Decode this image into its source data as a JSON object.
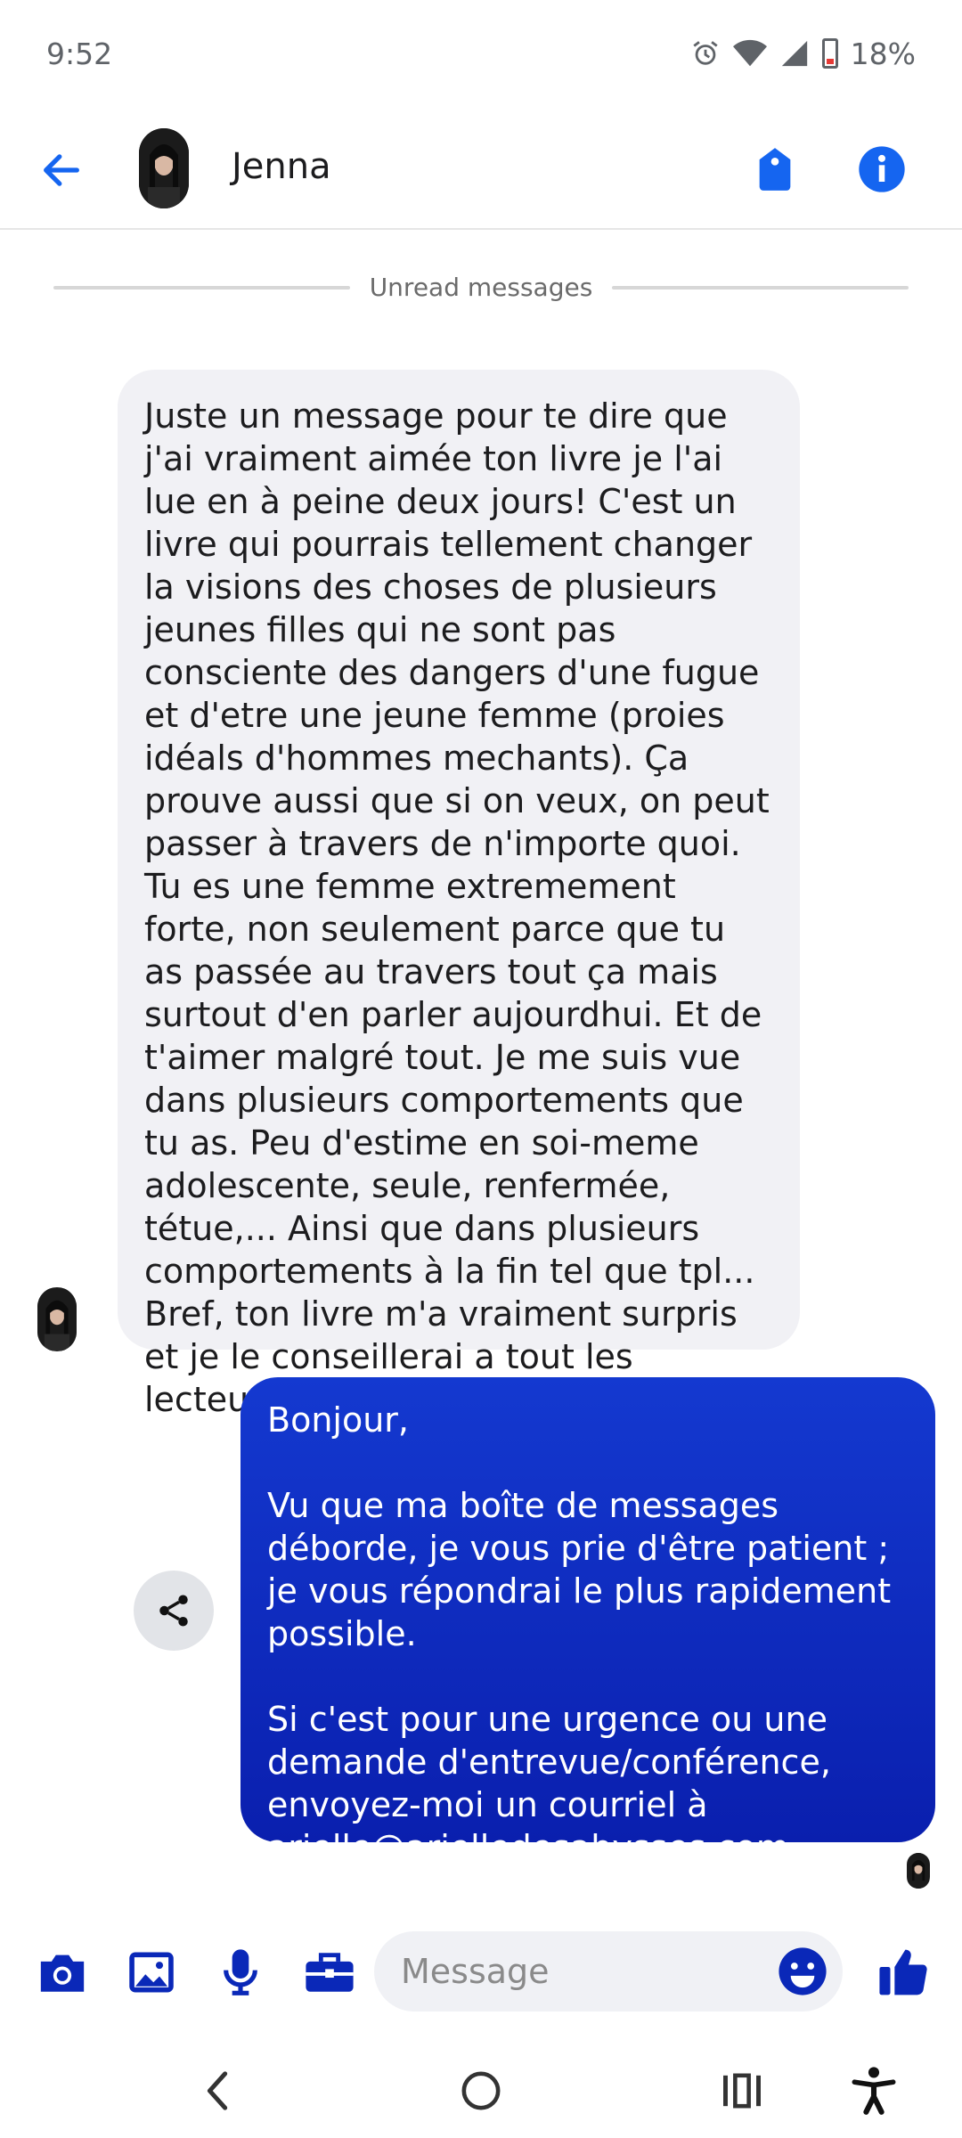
{
  "status_bar": {
    "time": "9:52",
    "battery": "18%"
  },
  "header": {
    "contact_name": "Jenna"
  },
  "divider": {
    "label": "Unread messages"
  },
  "messages": {
    "incoming": "Juste un message pour te dire que j'ai vraiment aimée ton livre je l'ai lue en à peine deux jours! C'est un livre qui pourrais tellement changer la visions des choses de plusieurs jeunes filles qui ne sont pas consciente des dangers d'une fugue et d'etre une jeune femme (proies idéals d'hommes mechants). Ça prouve aussi que si on veux, on peut passer à travers de n'importe quoi. Tu es une femme extremement forte, non seulement parce que tu as passée au travers tout ça mais surtout d'en parler aujourdhui. Et de t'aimer malgré tout. Je me suis vue dans plusieurs comportements que tu as. Peu d'estime en soi-meme adolescente, seule, renfermée, tétue,... Ainsi que dans plusieurs comportements à la fin tel que tpl... Bref, ton livre m'a vraiment surpris et je le conseillerai a tout les lecteurs",
    "incoming_emoji": "😉",
    "outgoing_p1": "Bonjour,",
    "outgoing_p2": "Vu que ma boîte de messages déborde, je vous prie d'être patient ; je vous répondrai le plus rapidement possible.",
    "outgoing_p3": "Si c'est pour une urgence ou une demande d'entrevue/conférence, envoyez-moi un courriel à",
    "outgoing_email": "arielle@arielledesabysses.com",
    "outgoing_end": "."
  },
  "composer": {
    "placeholder": "Message"
  },
  "colors": {
    "accent": "#1565f0",
    "brand_blue": "#0a1fae",
    "bubble_in": "#f1f1f5"
  },
  "icons": [
    "back-arrow-icon",
    "tag-icon",
    "info-icon",
    "share-icon",
    "camera-icon",
    "image-icon",
    "microphone-icon",
    "briefcase-icon",
    "emoji-icon",
    "thumbs-up-icon",
    "nav-back-icon",
    "nav-home-icon",
    "nav-recents-icon",
    "accessibility-icon"
  ]
}
